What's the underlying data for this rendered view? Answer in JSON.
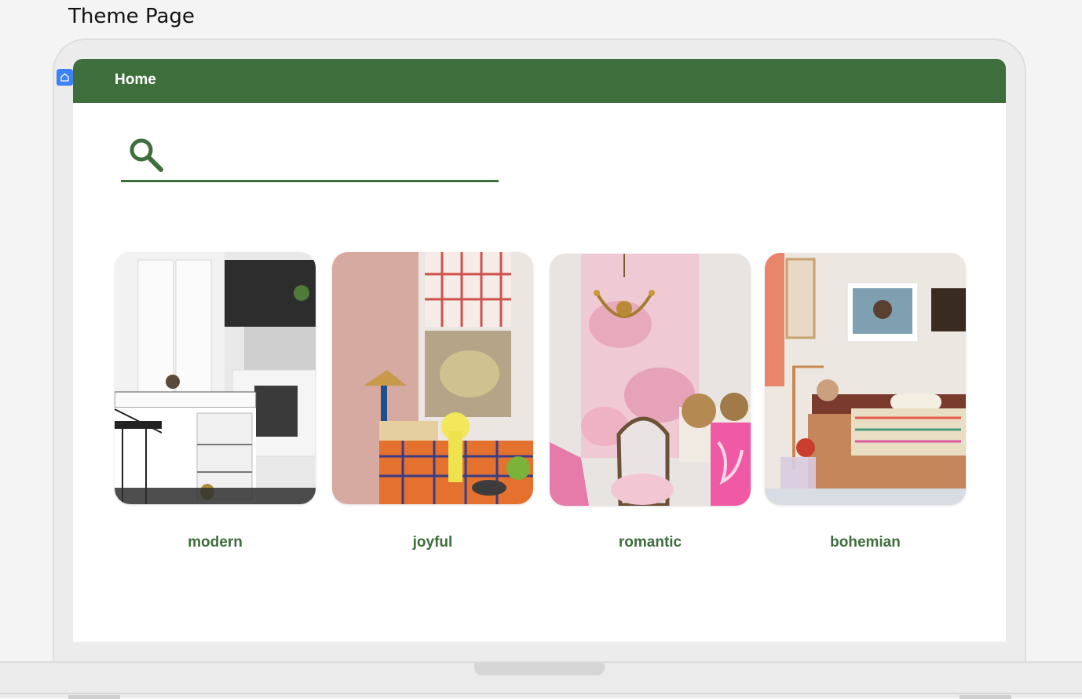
{
  "page": {
    "frame_title": "Theme Page"
  },
  "nav": {
    "home_label": "Home"
  },
  "search": {
    "value": "",
    "placeholder": ""
  },
  "themes": [
    {
      "label": "modern",
      "image": "modern-kitchen-photo"
    },
    {
      "label": "joyful",
      "image": "joyful-room-photo"
    },
    {
      "label": "romantic",
      "image": "romantic-room-photo"
    },
    {
      "label": "bohemian",
      "image": "bohemian-bedroom-photo"
    }
  ],
  "colors": {
    "accent": "#3e6e3c",
    "badge": "#3b82f6",
    "background": "#f4f4f4"
  }
}
